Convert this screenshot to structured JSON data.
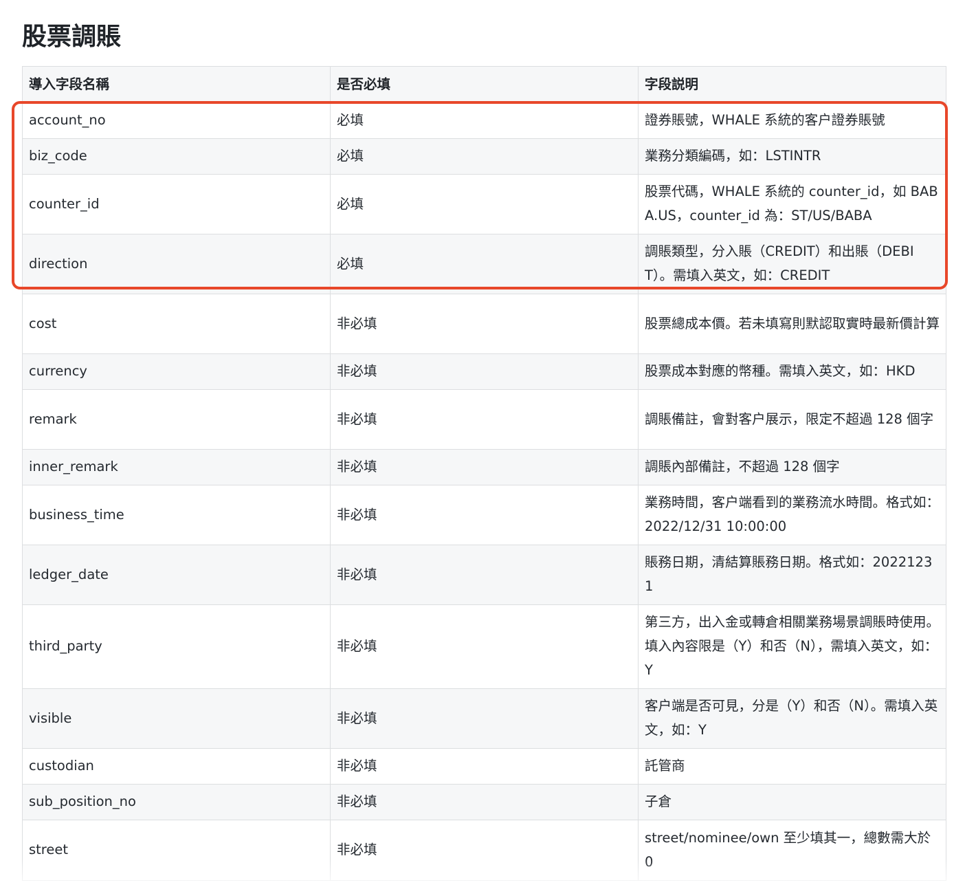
{
  "page": {
    "title": "股票調賬"
  },
  "table": {
    "headers": [
      "導入字段名稱",
      "是否必填",
      "字段説明"
    ],
    "rows": [
      [
        "account_no",
        "必填",
        "證券賬號，WHALE 系統的客户證券賬號"
      ],
      [
        "biz_code",
        "必填",
        "業務分類編碼，如：LSTINTR"
      ],
      [
        "counter_id",
        "必填",
        "股票代碼，WHALE 系統的 counter_id，如 BABA.US，counter_id 為：ST/US/BABA"
      ],
      [
        "direction",
        "必填",
        "調賬類型，分入賬（CREDIT）和出賬（DEBIT）。需填入英文，如：CREDIT"
      ],
      [
        "cost",
        "非必填",
        "股票總成本價。若未填寫則默認取實時最新價計算"
      ],
      [
        "currency",
        "非必填",
        "股票成本對應的幣種。需填入英文，如：HKD"
      ],
      [
        "remark",
        "非必填",
        "調賬備註，會對客户展示，限定不超過 128 個字"
      ],
      [
        "inner_remark",
        "非必填",
        "調賬內部備註，不超過 128 個字"
      ],
      [
        "business_time",
        "非必填",
        "業務時間，客户端看到的業務流水時間。格式如：2022/12/31 10:00:00"
      ],
      [
        "ledger_date",
        "非必填",
        "賬務日期，清結算賬務日期。格式如：20221231"
      ],
      [
        "third_party",
        "非必填",
        "第三方，出入金或轉倉相關業務場景調賬時使用。填入內容限是（Y）和否（N），需填入英文，如：Y"
      ],
      [
        "visible",
        "非必填",
        "客户端是否可見，分是（Y）和否（N）。需填入英文，如：Y"
      ],
      [
        "custodian",
        "非必填",
        "託管商"
      ],
      [
        "sub_position_no",
        "非必填",
        "子倉"
      ],
      [
        "street",
        "非必填",
        "street/nominee/own 至少填其一，總數需大於 0"
      ]
    ]
  },
  "colors": {
    "highlight_border": "#e8472a",
    "stripe": "#f6f7f8",
    "grid": "#dcdee0"
  }
}
